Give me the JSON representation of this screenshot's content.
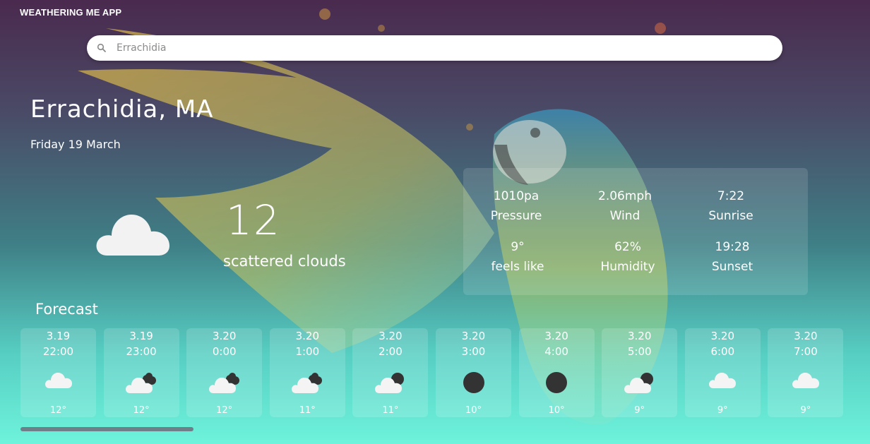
{
  "app": {
    "title": "WEATHERING ME APP"
  },
  "search": {
    "value": "Errachidia",
    "icon": "search-icon"
  },
  "location": {
    "city": "Errachidia, MA",
    "date": "Friday 19 March"
  },
  "current": {
    "temp": "12",
    "description": "scattered clouds",
    "icon": "cloud-icon"
  },
  "details": [
    {
      "value": "1010pa",
      "label": "Pressure"
    },
    {
      "value": "2.06mph",
      "label": "Wind"
    },
    {
      "value": "7:22",
      "label": "Sunrise"
    },
    {
      "value": "9°",
      "label": "feels like"
    },
    {
      "value": "62%",
      "label": "Humidity"
    },
    {
      "value": "19:28",
      "label": "Sunset"
    }
  ],
  "forecast": {
    "label": "Forecast",
    "items": [
      {
        "date": "3.19",
        "time": "22:00",
        "temp": "12°",
        "icon": "cloud-icon"
      },
      {
        "date": "3.19",
        "time": "23:00",
        "temp": "12°",
        "icon": "cloudy-night-icon"
      },
      {
        "date": "3.20",
        "time": "0:00",
        "temp": "12°",
        "icon": "cloudy-night-icon"
      },
      {
        "date": "3.20",
        "time": "1:00",
        "temp": "11°",
        "icon": "cloudy-night-icon"
      },
      {
        "date": "3.20",
        "time": "2:00",
        "temp": "11°",
        "icon": "partly-cloudy-night-icon"
      },
      {
        "date": "3.20",
        "time": "3:00",
        "temp": "10°",
        "icon": "clear-night-icon"
      },
      {
        "date": "3.20",
        "time": "4:00",
        "temp": "10°",
        "icon": "clear-night-icon"
      },
      {
        "date": "3.20",
        "time": "5:00",
        "temp": "9°",
        "icon": "partly-cloudy-night-icon"
      },
      {
        "date": "3.20",
        "time": "6:00",
        "temp": "9°",
        "icon": "cloud-icon"
      },
      {
        "date": "3.20",
        "time": "7:00",
        "temp": "9°",
        "icon": "cloud-icon"
      }
    ]
  }
}
